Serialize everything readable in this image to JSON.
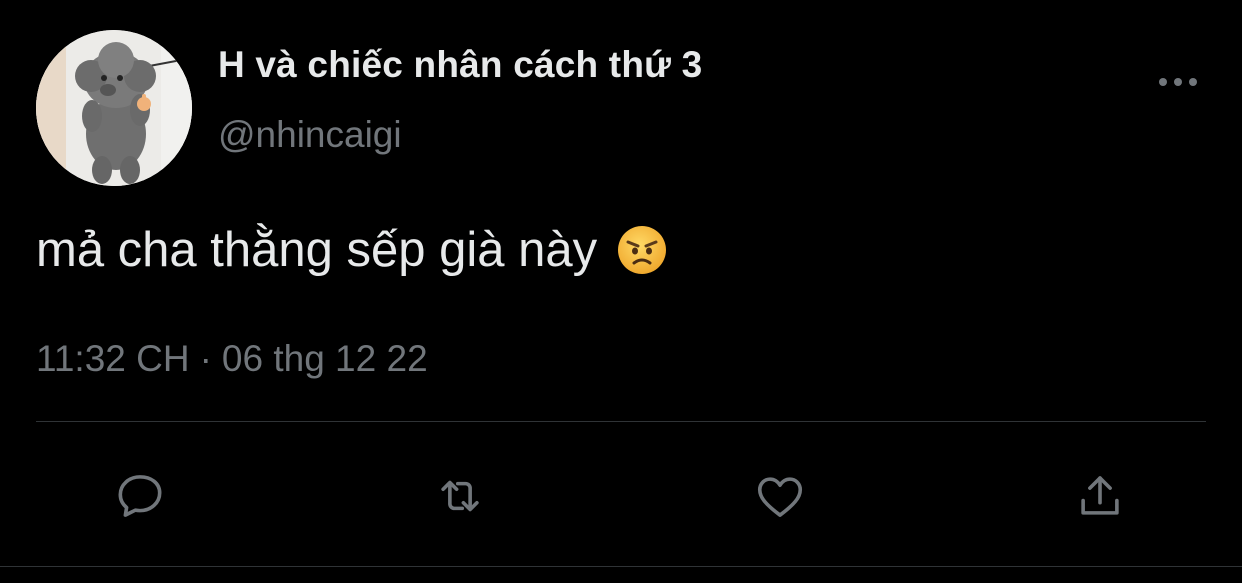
{
  "tweet": {
    "display_name": "H và chiếc nhân cách thứ 3",
    "handle": "@nhincaigi",
    "text": "mả cha thằng sếp già này",
    "emoji": "angry-face-icon",
    "time": "11:32 CH",
    "separator": "·",
    "date": "06 thg 12 22"
  },
  "actions": {
    "reply_icon": "reply-icon",
    "retweet_icon": "retweet-icon",
    "like_icon": "heart-icon",
    "share_icon": "share-icon",
    "more_icon": "more-options-icon"
  },
  "colors": {
    "background": "#000000",
    "primary_text": "#e7e9ea",
    "secondary_text": "#71767b",
    "divider": "#2f3336",
    "icon": "#71767b",
    "emoji_face": "#f5b83d"
  }
}
